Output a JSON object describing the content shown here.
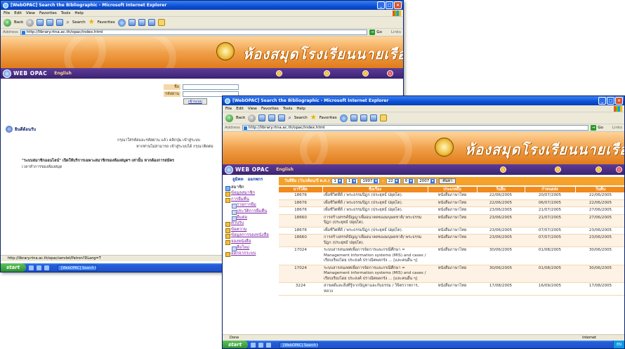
{
  "window1": {
    "title": "[WebOPAC] Search the Bibliographic - Microsoft Internet Explorer",
    "menu": [
      "File",
      "Edit",
      "View",
      "Favorites",
      "Tools",
      "Help"
    ],
    "toolbar": {
      "back": "Back",
      "search": "Search",
      "favorites": "Favorites"
    },
    "address": {
      "label": "Address",
      "url": "http://library.rtna.ac.th/opac/index.html",
      "go": "Go",
      "links": "Links"
    },
    "banner": {
      "library_name": "ห้องสมุดโรงเรียนนายเรือ"
    },
    "nav": {
      "opac": "WEB OPAC",
      "english": "English"
    },
    "login": {
      "user_label": "ชื่อ",
      "password_label": "รหัสผ่าน",
      "submit": "เข้าระบบ"
    },
    "welcome": "ยินดีต้อนรับ",
    "line1": "กรุณาใส่รหัสและรหัสผ่าน แล้ว คลิกปุ่ม เข้าสู่ระบบ",
    "line2": "หากท่านไม่สามารถ เข้าสู่ระบบได้ กรุณาติดต่อ",
    "line3": "\"ระบบสมาชิกออนไลน์\" เปิดให้บริการเฉพาะสมาชิกของห้องสมุดฯ เท่านั้น หากต้องการสมัคร",
    "line4": "เวลาทำการของห้องสมุด",
    "status": "http://library.rtna.ac.th/opac/servlet/Patron?DLang=T",
    "taskbar": {
      "start": "start",
      "task": "[WebOPAC] Search t..."
    }
  },
  "window2": {
    "title": "[WebOPAC] Search the Bibliographic - Microsoft Internet Explorer",
    "menu": [
      "File",
      "Edit",
      "View",
      "Favorites",
      "Tools",
      "Help"
    ],
    "toolbar": {
      "back": "Back",
      "search": "Search",
      "favorites": "Favorites"
    },
    "address": {
      "label": "Address",
      "url": "http://library.rtna.ac.th/opac/index.html",
      "go": "Go",
      "links": "Links"
    },
    "banner": {
      "library_name": "ห้องสมุดโรงเรียนนายเรือ"
    },
    "nav": {
      "opac": "WEB OPAC",
      "english": "English"
    },
    "sidebar": {
      "tabs": [
        "ลูมิคท",
        "ออกพกร"
      ],
      "root": "สมาชิก",
      "items": [
        {
          "label": "ข้อมูลสมาชิก",
          "level": 1,
          "link": true
        },
        {
          "label": "การยืมคืน",
          "level": 1,
          "link": true
        },
        {
          "label": "รายการยืม",
          "level": 2,
          "link": true
        },
        {
          "label": "ประวัติการยืมคืน",
          "level": 2,
          "link": true
        },
        {
          "label": "ยืมต่อ",
          "level": 2,
          "link": true
        },
        {
          "label": "ค่าปรับ",
          "level": 1,
          "link": true
        },
        {
          "label": "ข้อความ",
          "level": 1,
          "link": true
        },
        {
          "label": "ข้อมูลการจองหนังสือ",
          "level": 1,
          "link": true
        },
        {
          "label": "จองหนังสือ",
          "level": 1,
          "link": true
        },
        {
          "label": "สื่อใหม่",
          "level": 2,
          "link": true
        },
        {
          "label": "ออกจากระบบ",
          "level": 1,
          "link": true
        }
      ]
    },
    "search": {
      "label": "วันที่ยืม (วัน/เดือน/ปี ค.ศ.)",
      "from_day": "1",
      "from_month": "1",
      "from_year": "1997",
      "to_day": "22",
      "to_month": "6",
      "to_year": "2007",
      "button": "ค้นหา"
    },
    "table": {
      "headers": [
        "บาร์โค้ด",
        "ชื่อเรื่อง",
        "ประเภทสื่อ",
        "วันยืม",
        "กำหนดส่ง",
        "วันคืน"
      ],
      "rows": [
        [
          "18676",
          "เพื่อชีวิตที่ดี / พระธรรมปิฎก (ประยุทธ์ ปยุตฺโต).",
          "หนังสือภาษาไทย",
          "22/06/2005",
          "20/07/2005",
          "22/06/2005"
        ],
        [
          "18676",
          "เพื่อชีวิตที่ดี / พระธรรมปิฎก (ประยุทธ์ ปยุตฺโต).",
          "หนังสือภาษาไทย",
          "22/06/2005",
          "06/07/2005",
          "22/06/2005"
        ],
        [
          "18676",
          "เพื่อชีวิตที่ดี / พระธรรมปิฎก (ประยุทธ์ ปยุตฺโต).",
          "หนังสือภาษาไทย",
          "23/06/2005",
          "21/07/2005",
          "27/06/2005"
        ],
        [
          "18660",
          "การสร้างสรรค์ปัญญาเพื่ออนาคตของมนุษยชาติ/ พระธรรมปิฎก (ประยุทธ์ ปยุตฺโต).",
          "หนังสือภาษาไทย",
          "23/06/2005",
          "21/07/2005",
          "27/06/2005"
        ],
        [
          "18676",
          "เพื่อชีวิตที่ดี / พระธรรมปิฎก (ประยุทธ์ ปยุตฺโต).",
          "หนังสือภาษาไทย",
          "23/06/2005",
          "07/07/2005",
          "23/06/2005"
        ],
        [
          "18660",
          "การสร้างสรรค์ปัญญาเพื่ออนาคตของมนุษยชาติ/ พระธรรมปิฎก (ประยุทธ์ ปยุตฺโต).",
          "หนังสือภาษาไทย",
          "23/06/2005",
          "07/07/2005",
          "23/06/2005"
        ],
        [
          "17024",
          "ระบบสารสนเทศเพื่อการจัดการและกรณีศึกษา = Management information systems (MIS) and cases / เรียบเรียงโดย ประสงค์ ปราณีตพลกรัง ... [และคนอื่น ๆ]",
          "หนังสือภาษาไทย",
          "30/06/2005",
          "01/08/2005",
          "30/06/2005"
        ],
        [
          "17024",
          "ระบบสารสนเทศเพื่อการจัดการและกรณีศึกษา = Management information systems (MIS) and cases / เรียบเรียงโดย ประสงค์ ปราณีตพลกรัง ... [และคนอื่น ๆ]",
          "หนังสือภาษาไทย",
          "30/06/2005",
          "01/08/2005",
          "30/06/2005"
        ],
        [
          "3224",
          "สาขคดีและสิ่งที่รู้จากปัญหาและกับธรรม / วิจิตรวาทการ, หลวง",
          "หนังสือภาษาไทย",
          "17/08/2005",
          "16/09/2005",
          "17/08/2005"
        ]
      ]
    },
    "status": {
      "left": "Done",
      "right": "Internet"
    },
    "taskbar": {
      "start": "start",
      "task": "[WebOPAC] Search t...",
      "tray": "EN"
    }
  },
  "colors": {
    "banner": "#f0a04a",
    "nav": "#3b2370",
    "table_header": "#f28a1c",
    "search_strip": "#f6a12a",
    "xp_blue": "#0b4fd6"
  }
}
